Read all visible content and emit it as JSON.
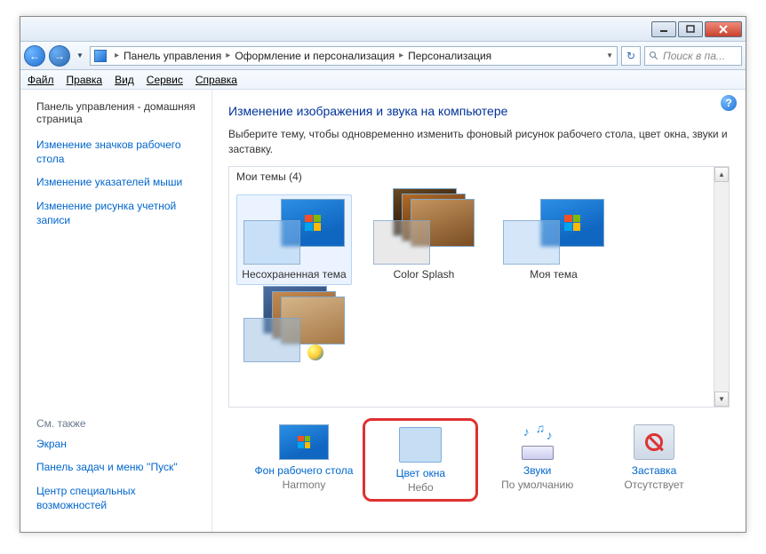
{
  "breadcrumb": {
    "item1": "Панель управления",
    "item2": "Оформление и персонализация",
    "item3": "Персонализация"
  },
  "search": {
    "placeholder": "Поиск в па..."
  },
  "menubar": {
    "file": "Файл",
    "edit": "Правка",
    "view": "Вид",
    "tools": "Сервис",
    "help": "Справка"
  },
  "sidebar": {
    "home": "Панель управления - домашняя страница",
    "links": {
      "icons": "Изменение значков рабочего стола",
      "pointers": "Изменение указателей мыши",
      "account_pic": "Изменение рисунка учетной записи"
    },
    "see_also": "См. также",
    "bottom": {
      "screen": "Экран",
      "taskbar": "Панель задач и меню ''Пуск''",
      "ease": "Центр специальных возможностей"
    }
  },
  "main": {
    "title": "Изменение изображения и звука на компьютере",
    "desc": "Выберите тему, чтобы одновременно изменить фоновый рисунок рабочего стола, цвет окна, звуки и заставку.",
    "themes_header": "Мои темы (4)",
    "themes": {
      "t1": "Несохраненная тема",
      "t2": "Color Splash",
      "t3": "Моя тема"
    },
    "settings": {
      "bg": {
        "label": "Фон рабочего стола",
        "value": "Harmony"
      },
      "color": {
        "label": "Цвет окна",
        "value": "Небо"
      },
      "sounds": {
        "label": "Звуки",
        "value": "По умолчанию"
      },
      "saver": {
        "label": "Заставка",
        "value": "Отсутствует"
      }
    }
  }
}
